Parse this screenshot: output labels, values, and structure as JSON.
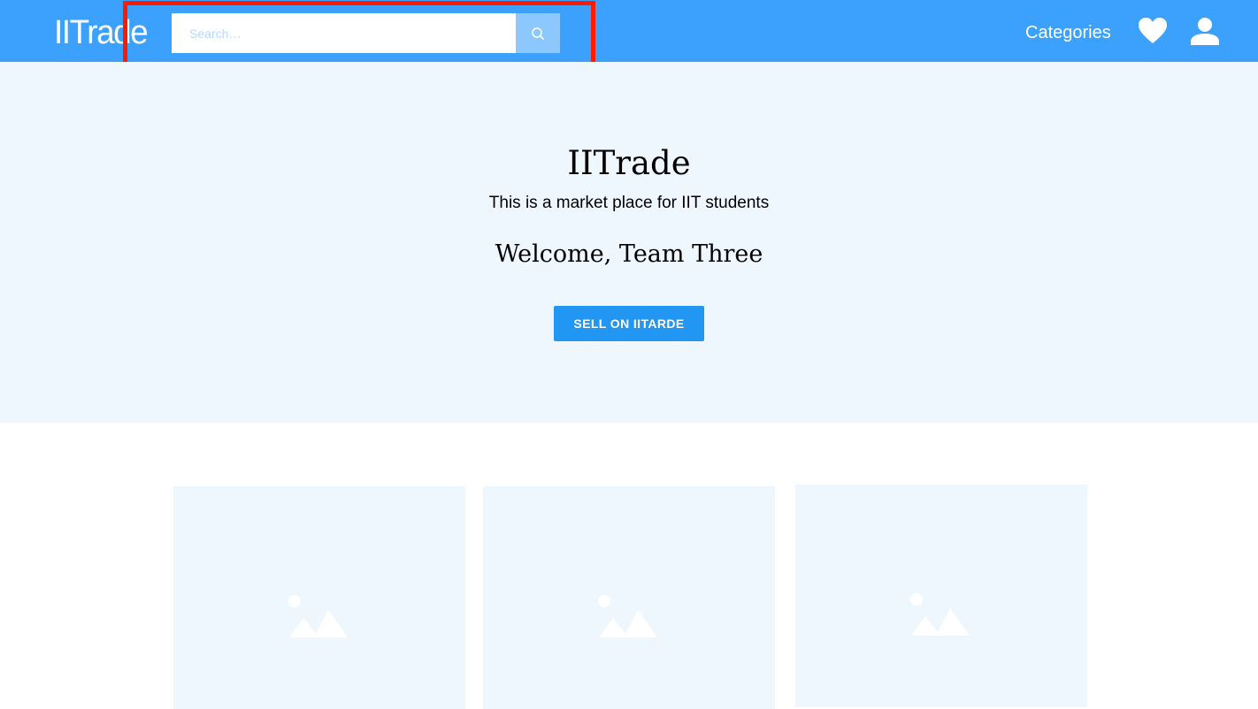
{
  "navbar": {
    "brand": "IITrade",
    "search": {
      "placeholder": "Search…",
      "value": ""
    },
    "search_button_icon": "search-icon",
    "categories_label": "Categories",
    "favorites_icon": "heart-icon",
    "account_icon": "user-icon",
    "background_color": "#3ba1fd",
    "highlight_color": "#ff1a00"
  },
  "hero": {
    "title": "IITrade",
    "subtitle": "This is a market place for IIT students",
    "welcome": "Welcome, Team Three",
    "sell_button_label": "SELL ON IITARDE",
    "background_color": "#eff7fe",
    "button_color": "#2196f3"
  },
  "products": {
    "cards": [
      {
        "image_icon": "image-placeholder-icon"
      },
      {
        "image_icon": "image-placeholder-icon"
      },
      {
        "image_icon": "image-placeholder-icon"
      }
    ]
  }
}
